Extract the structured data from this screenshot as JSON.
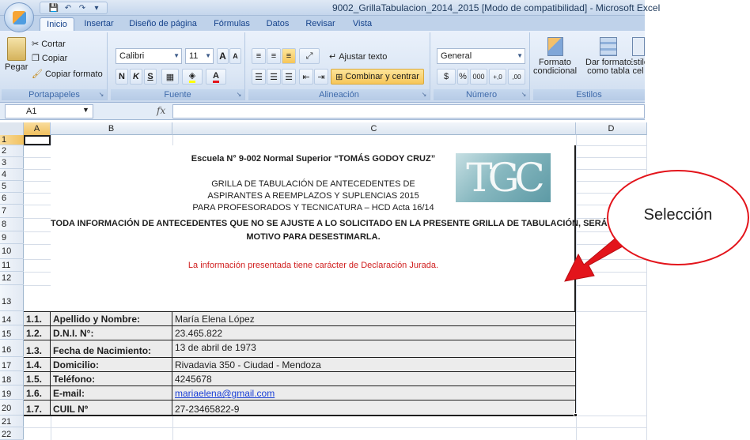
{
  "window": {
    "title": "9002_GrillaTabulacion_2014_2015  [Modo de compatibilidad] - Microsoft Excel"
  },
  "quick_access": {
    "save": "💾",
    "undo": "↶",
    "redo": "↷",
    "more": "▾"
  },
  "tabs": [
    "Inicio",
    "Insertar",
    "Diseño de página",
    "Fórmulas",
    "Datos",
    "Revisar",
    "Vista"
  ],
  "ribbon": {
    "clipboard": {
      "label": "Portapapeles",
      "paste": "Pegar",
      "cut": "Cortar",
      "copy": "Copiar",
      "format_painter": "Copiar formato"
    },
    "font": {
      "label": "Fuente",
      "font_name": "Calibri",
      "font_size": "11",
      "grow": "A",
      "shrink": "A",
      "bold": "N",
      "italic": "K",
      "underline": "S",
      "font_color": "A"
    },
    "alignment": {
      "label": "Alineación",
      "wrap": "Ajustar texto",
      "merge": "Combinar y centrar"
    },
    "number": {
      "label": "Número",
      "format": "General",
      "currency": "$",
      "percent": "%",
      "thousands": "000",
      "inc_decimals": "+,0",
      "dec_decimals": ",00"
    },
    "styles": {
      "label": "Estilos",
      "conditional_line1": "Formato",
      "conditional_line2": "condicional",
      "table_line1": "Dar formato",
      "table_line2": "como tabla",
      "cell_line1": "Estilo",
      "cell_line2": "cel"
    }
  },
  "formula_bar": {
    "name_box": "A1",
    "fx": "fx",
    "value": ""
  },
  "columns": [
    "A",
    "B",
    "C",
    "D"
  ],
  "rows": [
    "1",
    "2",
    "3",
    "4",
    "5",
    "6",
    "7",
    "8",
    "9",
    "10",
    "11",
    "12",
    "13",
    "14",
    "15",
    "16",
    "17",
    "18",
    "19",
    "20",
    "21",
    "22"
  ],
  "sheet_header": {
    "school": "Escuela N° 9-002 Normal Superior “TOMÁS GODOY CRUZ”",
    "grid_line1": "GRILLA DE TABULACIÓN DE ANTECEDENTES DE",
    "grid_line2": "ASPIRANTES A REEMPLAZOS Y SUPLENCIAS 2015",
    "grid_line3": "PARA PROFESORADOS  Y TECNICATURA – HCD Acta 16/14",
    "warning_line1": "TODA INFORMACIÓN DE ANTECEDENTES QUE NO SE AJUSTE A LO SOLICITADO EN LA PRESENTE GRILLA DE TABULACIÓN, SERÁ",
    "warning_line2": "MOTIVO PARA DESESTIMARLA.",
    "declaration": "La información presentada tiene carácter de Declaración Jurada.",
    "logo_text": "TGC"
  },
  "personal_data": [
    {
      "num": "1.1.",
      "label": "Apellido y Nombre:",
      "value": "María Elena López"
    },
    {
      "num": "1.2.",
      "label": "D.N.I. N°:",
      "value": "23.465.822"
    },
    {
      "num": "1.3.",
      "label": "Fecha de Nacimiento:",
      "value": "13 de abril de 1973"
    },
    {
      "num": "1.4.",
      "label": "Domicilio:",
      "value": "Rivadavia 350 - Ciudad - Mendoza"
    },
    {
      "num": "1.5.",
      "label": "Teléfono:",
      "value": "4245678"
    },
    {
      "num": "1.6.",
      "label": "E-mail:",
      "value": "mariaelena@gmail.com"
    },
    {
      "num": "1.7.",
      "label": "CUIL Nº",
      "value": "27-23465822-9"
    }
  ],
  "annotation": {
    "label": "Selección",
    "color": "#e3141b"
  }
}
